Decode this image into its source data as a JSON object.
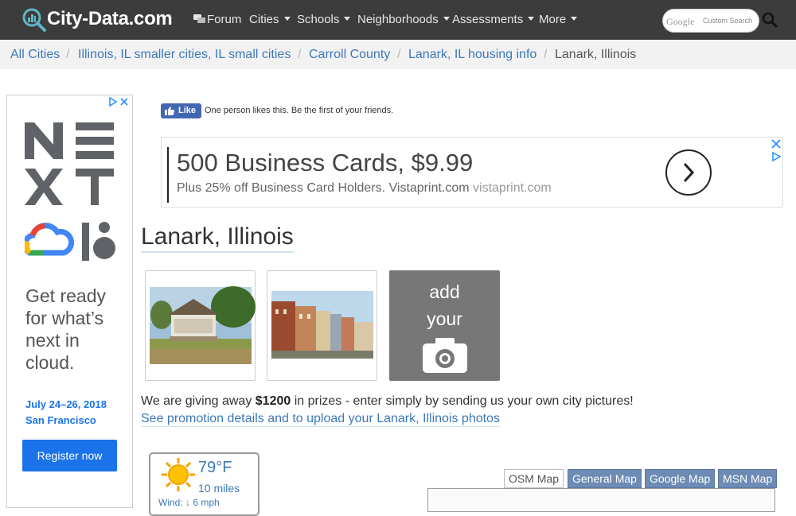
{
  "navbar": {
    "logo_text": "City-Data.com",
    "items": [
      {
        "label": "Forum",
        "has_caret": false
      },
      {
        "label": "Cities",
        "has_caret": true
      },
      {
        "label": "Schools",
        "has_caret": true
      },
      {
        "label": "Neighborhoods",
        "has_caret": true
      },
      {
        "label": "Assessments",
        "has_caret": true
      },
      {
        "label": "More",
        "has_caret": true
      }
    ],
    "search": {
      "brand": "Google",
      "label": "Custom Search"
    }
  },
  "breadcrumb": [
    {
      "label": "All Cities"
    },
    {
      "label": "Illinois, IL smaller cities, IL small cities"
    },
    {
      "label": "Carroll County"
    },
    {
      "label": "Lanark, IL housing info"
    },
    {
      "label": "Lanark, Illinois"
    }
  ],
  "left_ad": {
    "tagline": "Get ready for what’s next in cloud.",
    "date": "July 24–26, 2018",
    "city": "San Francisco",
    "button": "Register now",
    "brand_color": "#1a73e8"
  },
  "fb": {
    "like_label": "Like",
    "text": "One person likes this. Be the first of your friends."
  },
  "top_ad": {
    "title": "500 Business Cards, $9.99",
    "subtitle": "Plus 25% off Business Card Holders. Vistaprint.com",
    "domain": "vistaprint.com"
  },
  "page_title": "Lanark, Illinois",
  "add_photo": {
    "line1": "add",
    "line2": "your"
  },
  "promo": {
    "prefix": "We are giving away ",
    "amount": "$1200",
    "suffix": " in prizes - enter simply by sending us your own city pictures!",
    "link": "See promotion details and to upload your Lanark, Illinois photos"
  },
  "weather": {
    "temp": "79°F",
    "distance": "10 miles",
    "wind": "Wind: ↓ 6 mph"
  },
  "map_buttons": [
    {
      "label": "OSM Map",
      "active": true
    },
    {
      "label": "General Map",
      "active": false
    },
    {
      "label": "Google Map",
      "active": false
    },
    {
      "label": "MSN Map",
      "active": false
    }
  ],
  "colors": {
    "navbar": "#3c3c3c",
    "link": "#3d78b8",
    "accent_underline": "#cfe6ea"
  }
}
